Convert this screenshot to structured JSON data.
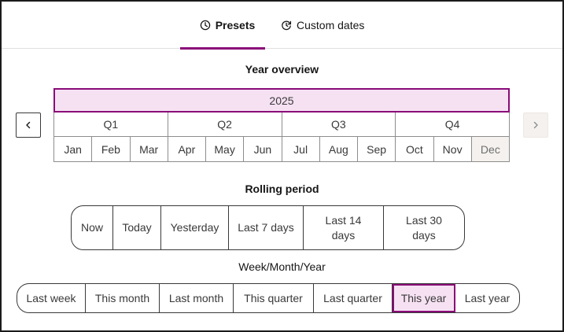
{
  "tabs": [
    {
      "label": "Presets",
      "icon": "clock-icon",
      "active": true
    },
    {
      "label": "Custom dates",
      "icon": "refresh-clock-icon",
      "active": false
    }
  ],
  "year_overview": {
    "title": "Year overview",
    "year": "2025",
    "quarters": [
      "Q1",
      "Q2",
      "Q3",
      "Q4"
    ],
    "months": [
      "Jan",
      "Feb",
      "Mar",
      "Apr",
      "May",
      "Jun",
      "Jul",
      "Aug",
      "Sep",
      "Oct",
      "Nov",
      "Dec"
    ],
    "muted_month": "Dec"
  },
  "rolling_period": {
    "title": "Rolling period",
    "options": [
      "Now",
      "Today",
      "Yesterday",
      "Last 7 days",
      "Last 14 days",
      "Last 30 days"
    ]
  },
  "week_month_year": {
    "title": "Week/Month/Year",
    "options": [
      "Last week",
      "This month",
      "Last month",
      "This quarter",
      "Last quarter",
      "This year",
      "Last year"
    ],
    "selected": "This year"
  },
  "colors": {
    "accent": "#8a0b78",
    "selected_bg": "#f6e1f3",
    "muted_bg": "#f4f1ee"
  }
}
